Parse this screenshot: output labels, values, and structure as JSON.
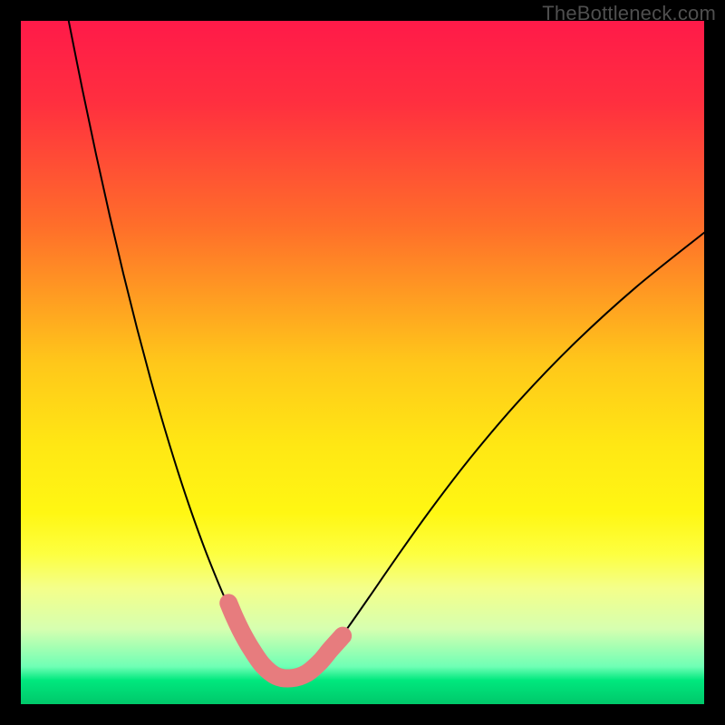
{
  "watermark": "TheBottleneck.com",
  "chart_data": {
    "type": "line",
    "title": "",
    "xlabel": "",
    "ylabel": "",
    "xlim": [
      0,
      100
    ],
    "ylim": [
      0,
      100
    ],
    "gradient_stops": [
      {
        "offset": 0.0,
        "color": "#ff1a49"
      },
      {
        "offset": 0.12,
        "color": "#ff2f3f"
      },
      {
        "offset": 0.3,
        "color": "#ff6e2a"
      },
      {
        "offset": 0.5,
        "color": "#ffc71a"
      },
      {
        "offset": 0.62,
        "color": "#ffe714"
      },
      {
        "offset": 0.72,
        "color": "#fff713"
      },
      {
        "offset": 0.78,
        "color": "#fdff40"
      },
      {
        "offset": 0.83,
        "color": "#f4ff8a"
      },
      {
        "offset": 0.89,
        "color": "#d6ffb0"
      },
      {
        "offset": 0.945,
        "color": "#6fffb5"
      },
      {
        "offset": 0.965,
        "color": "#00e87e"
      },
      {
        "offset": 1.0,
        "color": "#00c86a"
      }
    ],
    "series": [
      {
        "name": "left-curve",
        "x": [
          7,
          9,
          11,
          13,
          15,
          17,
          19,
          21,
          23,
          25,
          27,
          29,
          30,
          31,
          32,
          33,
          34,
          35,
          36
        ],
        "y": [
          100,
          90,
          80.5,
          71.5,
          63,
          55,
          47.5,
          40.5,
          34,
          28,
          22.5,
          17.5,
          15.2,
          13,
          11,
          9.1,
          7.4,
          5.8,
          4.4
        ]
      },
      {
        "name": "right-curve",
        "x": [
          42,
          44,
          46,
          48,
          51,
          55,
          60,
          66,
          73,
          81,
          90,
          100
        ],
        "y": [
          4.4,
          6.3,
          8.7,
          11.4,
          15.7,
          21.5,
          28.5,
          36.3,
          44.5,
          52.8,
          61,
          69
        ]
      },
      {
        "name": "floor-segment",
        "x": [
          36,
          37.5,
          39,
          40.5,
          42
        ],
        "y": [
          4.4,
          3.9,
          3.8,
          3.9,
          4.4
        ]
      }
    ],
    "markers": [
      {
        "x": 30.4,
        "y": 14.8,
        "r": 1.35
      },
      {
        "x": 31.2,
        "y": 12.9,
        "r": 1.35
      },
      {
        "x": 32.3,
        "y": 10.6,
        "r": 1.35
      },
      {
        "x": 33.6,
        "y": 8.3,
        "r": 1.35
      },
      {
        "x": 35.4,
        "y": 5.7,
        "r": 1.35
      },
      {
        "x": 37.4,
        "y": 4.1,
        "r": 1.35
      },
      {
        "x": 39.6,
        "y": 3.8,
        "r": 1.35
      },
      {
        "x": 41.8,
        "y": 4.5,
        "r": 1.35
      },
      {
        "x": 43.8,
        "y": 6.2,
        "r": 1.35
      },
      {
        "x": 45.3,
        "y": 8.0,
        "r": 1.35
      },
      {
        "x": 47.1,
        "y": 10.0,
        "r": 1.15
      }
    ],
    "marker_color": "#e77c7e",
    "curve_color": "#000000",
    "curve_width": 2.0
  }
}
